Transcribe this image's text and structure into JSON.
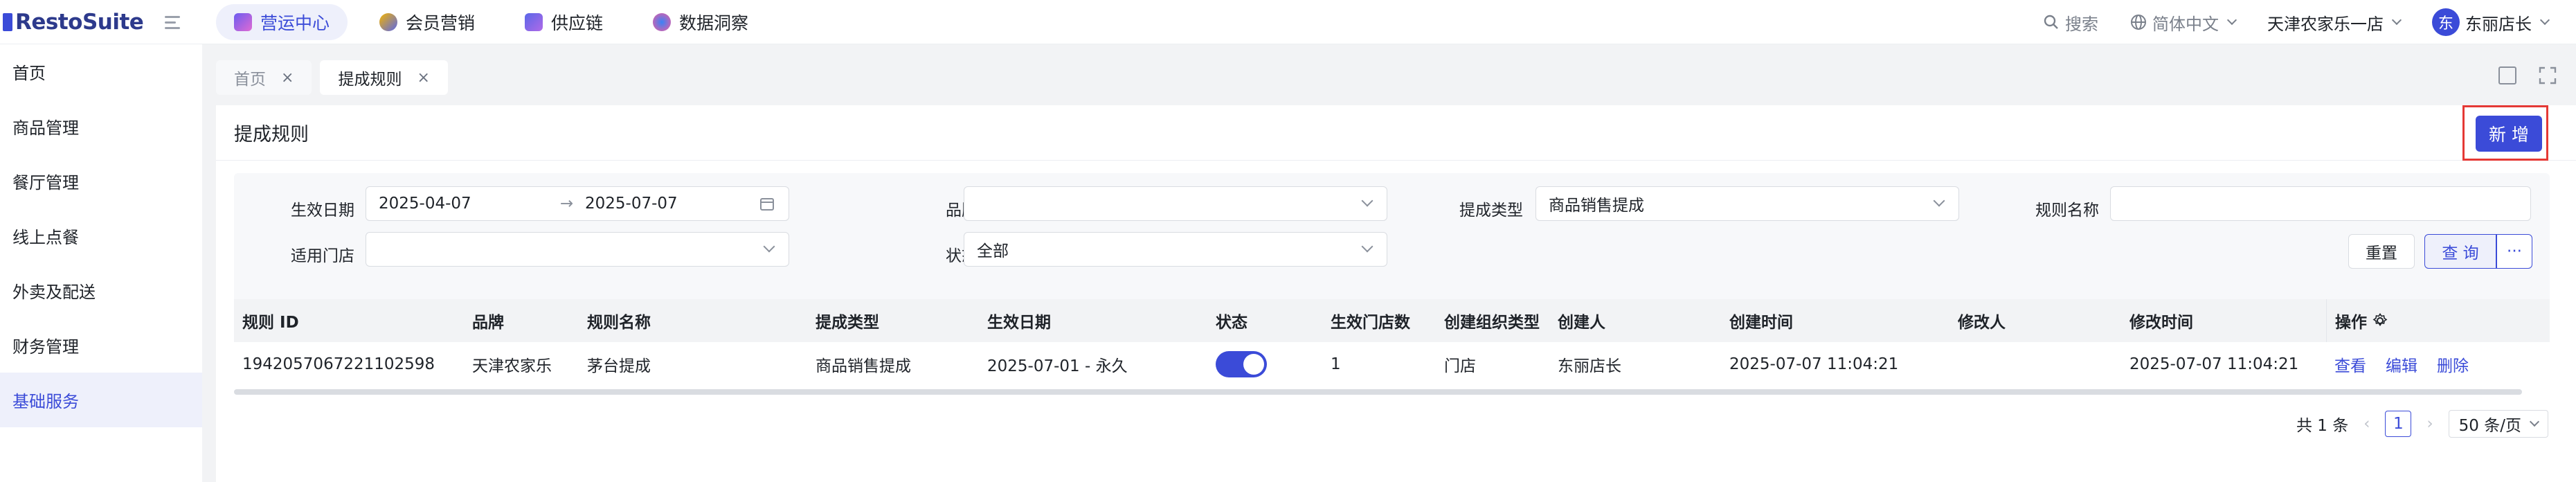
{
  "app": {
    "logo_text": "RestoSuite"
  },
  "topnav": {
    "items": [
      {
        "label": "营运中心",
        "active": true
      },
      {
        "label": "会员营销"
      },
      {
        "label": "供应链"
      },
      {
        "label": "数据洞察"
      }
    ]
  },
  "topright": {
    "search": "搜索",
    "language": "简体中文",
    "store": "天津农家乐一店",
    "avatar_char": "东",
    "user": "东丽店长"
  },
  "sidebar": {
    "items": [
      {
        "label": "首页"
      },
      {
        "label": "商品管理"
      },
      {
        "label": "餐厅管理"
      },
      {
        "label": "线上点餐"
      },
      {
        "label": "外卖及配送"
      },
      {
        "label": "财务管理"
      },
      {
        "label": "基础服务",
        "active": true
      }
    ]
  },
  "tabs": [
    {
      "label": "首页",
      "close": "×"
    },
    {
      "label": "提成规则",
      "close": "×",
      "active": true
    }
  ],
  "page": {
    "title": "提成规则",
    "add_button": "新 增"
  },
  "filters": {
    "effective_date_label": "生效日期",
    "date_start": "2025-04-07",
    "date_end": "2025-07-07",
    "date_sep": "→",
    "brand_label": "品牌",
    "brand_value": "",
    "commission_type_label": "提成类型",
    "commission_type_value": "商品销售提成",
    "rule_name_label": "规则名称",
    "rule_name_value": "",
    "store_label": "适用门店",
    "store_value": "",
    "status_label": "状态",
    "status_value": "全部",
    "reset_button": "重置",
    "query_button": "查 询",
    "more_button": "···"
  },
  "table": {
    "columns": [
      "规则 ID",
      "品牌",
      "规则名称",
      "提成类型",
      "生效日期",
      "状态",
      "生效门店数",
      "创建组织类型",
      "创建人",
      "创建时间",
      "修改人",
      "修改时间",
      "操作"
    ],
    "rows": [
      {
        "id": "1942057067221102598",
        "brand": "天津农家乐",
        "name": "茅台提成",
        "type": "商品销售提成",
        "date": "2025-07-01 - 永久",
        "status_on": true,
        "store_count": "1",
        "org_type": "门店",
        "creator": "东丽店长",
        "created": "2025-07-07 11:04:21",
        "modifier": "",
        "modified": "2025-07-07 11:04:21",
        "actions": [
          "查看",
          "编辑",
          "删除"
        ]
      }
    ]
  },
  "pager": {
    "total": "共 1 条",
    "page": "1",
    "page_size": "50 条/页"
  },
  "colors": {
    "accent": "#3b4bd8",
    "highlight_border": "#e53935"
  }
}
